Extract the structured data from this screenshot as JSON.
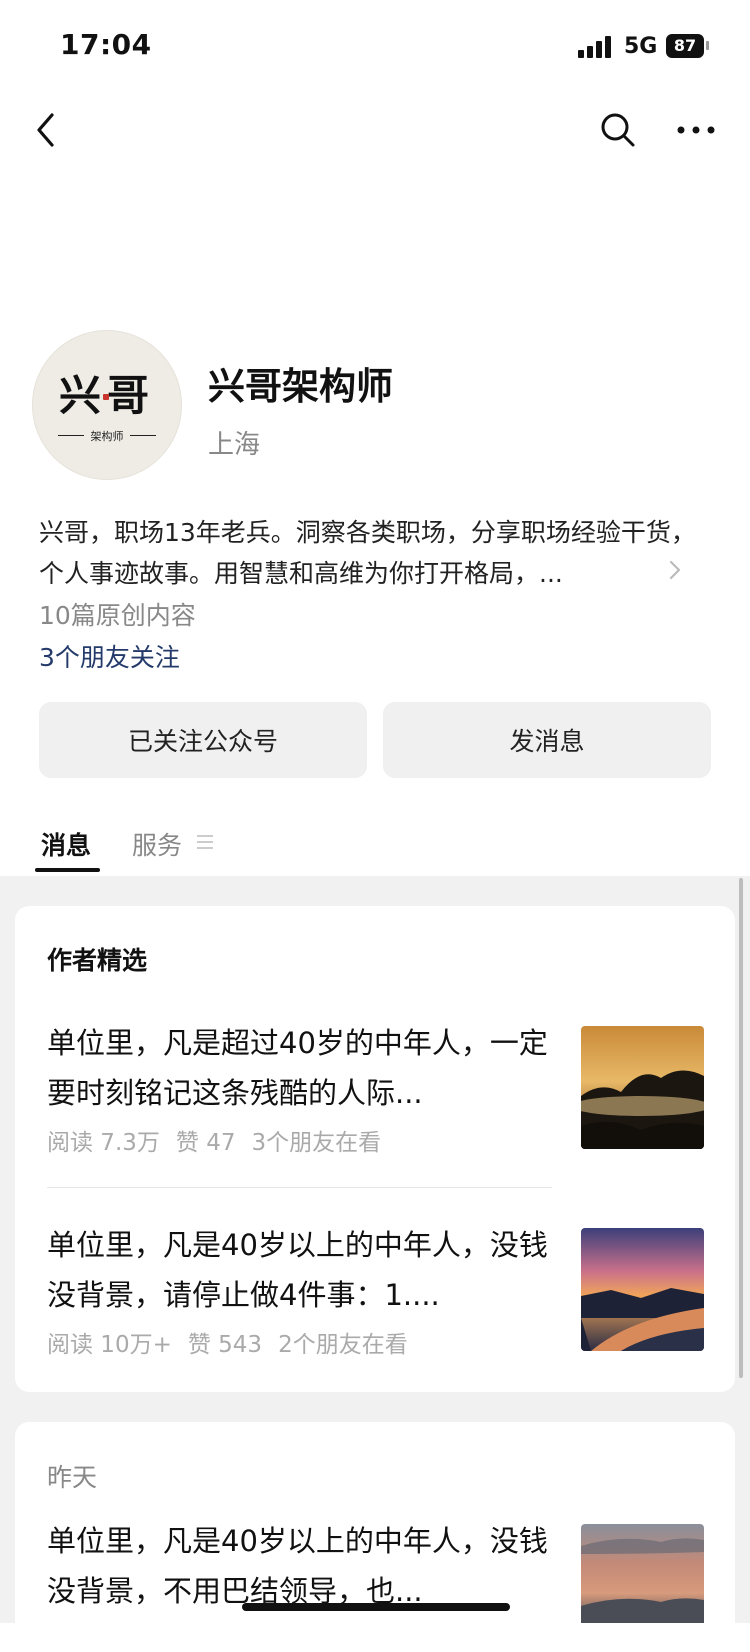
{
  "status_bar": {
    "time": "17:04",
    "network": "5G",
    "battery": "87"
  },
  "nav": {
    "back_icon": "chevron-left-icon",
    "search_icon": "search-icon",
    "more_icon": "more-horizontal-icon"
  },
  "profile": {
    "avatar_title": "兴哥",
    "avatar_subtitle": "架构师",
    "name": "兴哥架构师",
    "location": "上海",
    "bio": "兴哥，职场13年老兵。洞察各类职场，分享职场经验干货，个人事迹故事。用智慧和高维为你打开格局，...",
    "original_count": "10篇原创内容",
    "friends_following": "3个朋友关注"
  },
  "actions": {
    "follow_label": "已关注公众号",
    "message_label": "发消息"
  },
  "tabs": [
    {
      "label": "消息"
    },
    {
      "label": "服务"
    }
  ],
  "featured": {
    "title": "作者精选",
    "articles": [
      {
        "title": "单位里，凡是超过40岁的中年人，一定要时刻铭记这条残酷的人际...",
        "reads": "阅读 7.3万",
        "likes": "赞 47",
        "friends": "3个朋友在看"
      },
      {
        "title": "单位里，凡是40岁以上的中年人，没钱没背景，请停止做4件事：1....",
        "reads": "阅读 10万+",
        "likes": "赞 543",
        "friends": "2个朋友在看"
      }
    ]
  },
  "yesterday": {
    "label": "昨天",
    "article": {
      "title": "单位里，凡是40岁以上的中年人，没钱没背景，不用巴结领导，也..."
    }
  },
  "colors": {
    "link": "#243a6a",
    "muted": "#888888",
    "button_bg": "#f0f0f0",
    "feed_bg": "#f1f1f1"
  }
}
